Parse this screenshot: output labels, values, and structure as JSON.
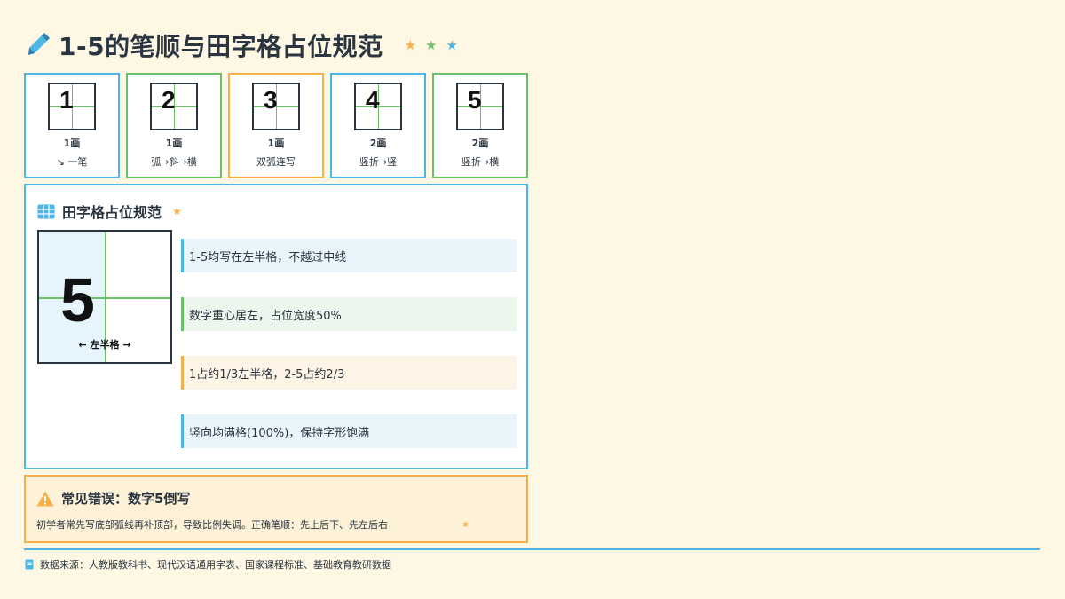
{
  "header": {
    "title": "1-5的笔顺与田字格占位规范",
    "stars": [
      "★",
      "★",
      "★"
    ]
  },
  "digit_cards": [
    {
      "digit": "1",
      "strokes": "1画",
      "order": "↘ 一笔",
      "accent": "#4db6e6"
    },
    {
      "digit": "2",
      "strokes": "1画",
      "order": "弧→斜→横",
      "accent": "#6cbf6a"
    },
    {
      "digit": "3",
      "strokes": "1画",
      "order": "双弧连写",
      "accent": "#f5b04a"
    },
    {
      "digit": "4",
      "strokes": "2画",
      "order": "竖折→竖",
      "accent": "#4db6e6"
    },
    {
      "digit": "5",
      "strokes": "2画",
      "order": "竖折→横",
      "accent": "#6cbf6a"
    }
  ],
  "placement": {
    "title": "田字格占位规范",
    "star": "★",
    "example_digit": "5",
    "half_label": "← 左半格 →",
    "rules": [
      "1-5均写在左半格，不越过中线",
      "数字重心居左，占位宽度50%",
      "1占约1/3左半格，2-5占约2/3",
      "竖向均满格(100%)，保持字形饱满"
    ]
  },
  "warning": {
    "title": "常见错误：数字5倒写",
    "text": "初学者常先写底部弧线再补顶部，导致比例失调。正确笔顺：先上后下、先左后右",
    "star": "★"
  },
  "footer": {
    "source": "数据来源：人教版教科书、现代汉语通用字表、国家课程标准、基础教育教研数据"
  },
  "colors": {
    "background": "#fdf7e4",
    "blue": "#4db6e6",
    "green": "#6cbf6a",
    "orange": "#f5b04a",
    "text": "#2b3540"
  }
}
